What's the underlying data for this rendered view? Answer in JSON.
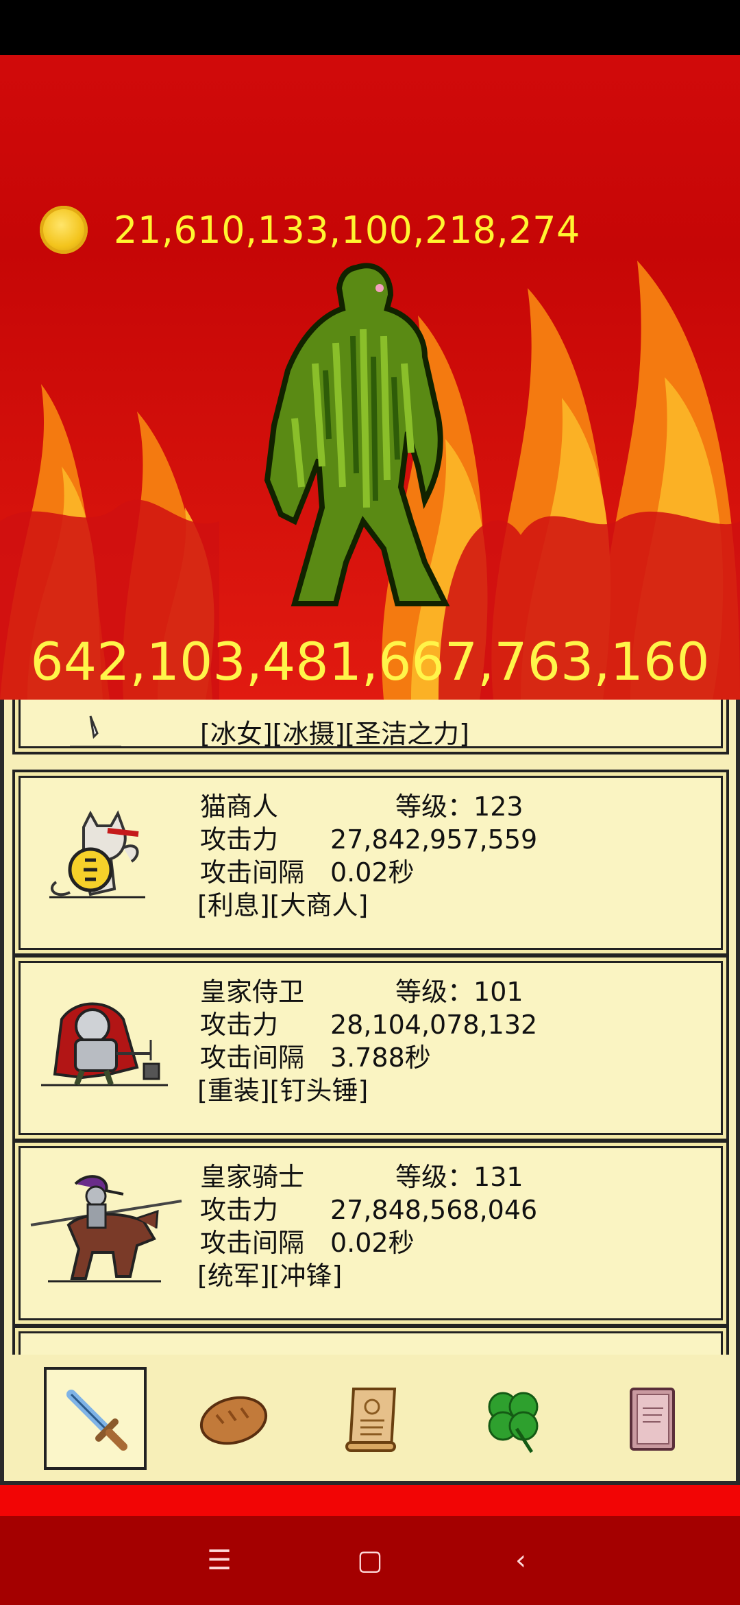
{
  "gold": {
    "icon": "gold-coin-icon",
    "amount": "21,610,133,100,218,274"
  },
  "monster": {
    "icon": "green-moss-monster",
    "hp": "642,103,481,667,763,160"
  },
  "heroes_partial": {
    "traits": "[冰女][冰摄][圣洁之力]"
  },
  "heroes": [
    {
      "name": "猫商人",
      "level_label": "等级：",
      "level": "123",
      "attack_label": "攻击力",
      "attack": "27,842,957,559",
      "interval_label": "攻击间隔",
      "interval": "0.02秒",
      "traits": "[利息][大商人]",
      "icon": "cat-merchant-icon"
    },
    {
      "name": "皇家侍卫",
      "level_label": "等级：",
      "level": "101",
      "attack_label": "攻击力",
      "attack": "28,104,078,132",
      "interval_label": "攻击间隔",
      "interval": "3.788秒",
      "traits": "[重装][钉头锤]",
      "icon": "royal-guard-icon"
    },
    {
      "name": "皇家骑士",
      "level_label": "等级：",
      "level": "131",
      "attack_label": "攻击力",
      "attack": "27,848,568,046",
      "interval_label": "攻击间隔",
      "interval": "0.02秒",
      "traits": "[统军][冲锋]",
      "icon": "royal-knight-icon"
    }
  ],
  "tabs": [
    "sword-icon",
    "bread-icon",
    "scroll-icon",
    "clover-icon",
    "book-icon"
  ],
  "nav": {
    "menu": "☰",
    "home": "▢",
    "back": "‹"
  }
}
